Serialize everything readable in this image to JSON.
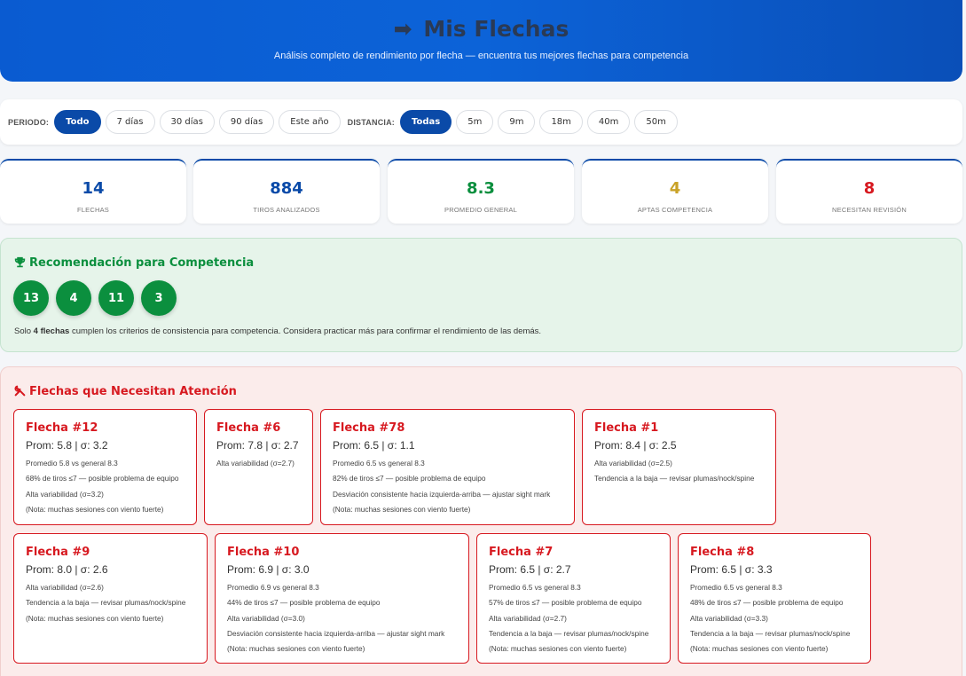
{
  "header": {
    "arrow": "➡",
    "title": "Mis Flechas",
    "subtitle": "Análisis completo de rendimiento por flecha — encuentra tus mejores flechas para competencia"
  },
  "filters": {
    "periodo_label": "PERIODO:",
    "periodo": [
      "Todo",
      "7 días",
      "30 días",
      "90 días",
      "Este año"
    ],
    "periodo_selected": "Todo",
    "distancia_label": "DISTANCIA:",
    "distancia": [
      "Todas",
      "5m",
      "9m",
      "18m",
      "40m",
      "50m"
    ],
    "distancia_selected": "Todas"
  },
  "stats": [
    {
      "value": "14",
      "label": "FLECHAS",
      "color": "#0a4aa8"
    },
    {
      "value": "884",
      "label": "TIROS ANALIZADOS",
      "color": "#0a4aa8"
    },
    {
      "value": "8.3",
      "label": "PROMEDIO GENERAL",
      "color": "#0b8f3e"
    },
    {
      "value": "4",
      "label": "APTAS COMPETENCIA",
      "color": "#c9a227"
    },
    {
      "value": "8",
      "label": "NECESITAN REVISIÓN",
      "color": "#d71920"
    }
  ],
  "recommendation": {
    "title": "Recomendación para Competencia",
    "arrows": [
      "13",
      "4",
      "11",
      "3"
    ],
    "note_prefix": "Solo ",
    "note_bold": "4 flechas",
    "note_suffix": " cumplen los criterios de consistencia para competencia. Considera practicar más para confirmar el rendimiento de las demás."
  },
  "attention": {
    "title": "Flechas que Necesitan Atención",
    "cards": [
      {
        "title": "Flecha #12",
        "prom": "Prom: 5.8 | σ: 3.2",
        "lines": [
          "Promedio 5.8 vs general 8.3",
          "68% de tiros ≤7 — posible problema de equipo",
          "Alta variabilidad (σ=3.2)",
          "(Nota: muchas sesiones con viento fuerte)"
        ]
      },
      {
        "title": "Flecha #6",
        "prom": "Prom: 7.8 | σ: 2.7",
        "lines": [
          "Alta variabilidad (σ=2.7)"
        ]
      },
      {
        "title": "Flecha #78",
        "prom": "Prom: 6.5 | σ: 1.1",
        "lines": [
          "Promedio 6.5 vs general 8.3",
          "82% de tiros ≤7 — posible problema de equipo",
          "Desviación consistente hacia izquierda-arriba — ajustar sight mark",
          "(Nota: muchas sesiones con viento fuerte)"
        ]
      },
      {
        "title": "Flecha #1",
        "prom": "Prom: 8.4 | σ: 2.5",
        "lines": [
          "Alta variabilidad (σ=2.5)",
          "Tendencia a la baja — revisar plumas/nock/spine"
        ]
      },
      {
        "title": "Flecha #9",
        "prom": "Prom: 8.0 | σ: 2.6",
        "lines": [
          "Alta variabilidad (σ=2.6)",
          "Tendencia a la baja — revisar plumas/nock/spine",
          "(Nota: muchas sesiones con viento fuerte)"
        ]
      },
      {
        "title": "Flecha #10",
        "prom": "Prom: 6.9 | σ: 3.0",
        "lines": [
          "Promedio 6.9 vs general 8.3",
          "44% de tiros ≤7 — posible problema de equipo",
          "Alta variabilidad (σ=3.0)",
          "Desviación consistente hacia izquierda-arriba — ajustar sight mark",
          "(Nota: muchas sesiones con viento fuerte)"
        ]
      },
      {
        "title": "Flecha #7",
        "prom": "Prom: 6.5 | σ: 2.7",
        "lines": [
          "Promedio 6.5 vs general 8.3",
          "57% de tiros ≤7 — posible problema de equipo",
          "Alta variabilidad (σ=2.7)",
          "Tendencia a la baja — revisar plumas/nock/spine",
          "(Nota: muchas sesiones con viento fuerte)"
        ]
      },
      {
        "title": "Flecha #8",
        "prom": "Prom: 6.5 | σ: 3.3",
        "lines": [
          "Promedio 6.5 vs general 8.3",
          "48% de tiros ≤7 — posible problema de equipo",
          "Alta variabilidad (σ=3.3)",
          "Tendencia a la baja — revisar plumas/nock/spine",
          "(Nota: muchas sesiones con viento fuerte)"
        ]
      }
    ]
  },
  "icons": {
    "trophy": "trophy-icon",
    "tools": "tools-icon"
  },
  "colors": {
    "primary": "#0a4aa8",
    "success": "#0b8f3e",
    "warning": "#c9a227",
    "danger": "#d71920"
  }
}
